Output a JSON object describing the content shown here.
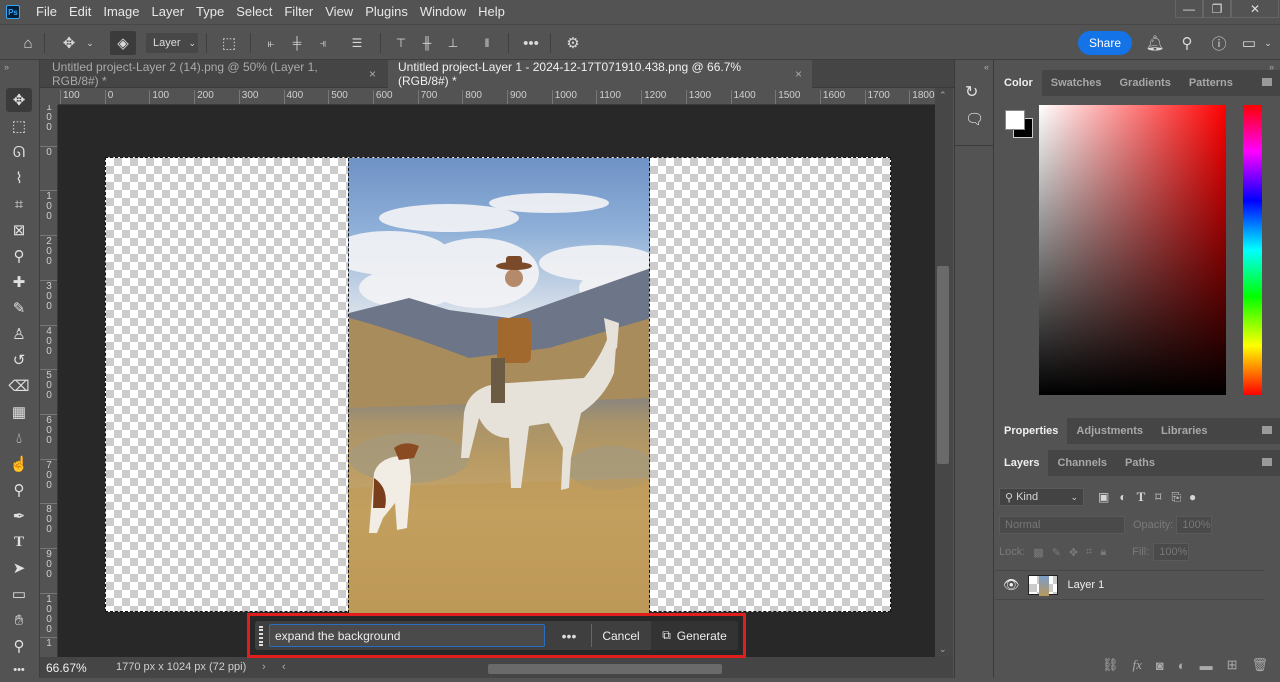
{
  "app": {
    "logo": "Ps",
    "name": "Photoshop"
  },
  "menu": [
    "File",
    "Edit",
    "Image",
    "Layer",
    "Type",
    "Select",
    "Filter",
    "View",
    "Plugins",
    "Window",
    "Help"
  ],
  "window_controls": {
    "minimize": "—",
    "restore": "❐",
    "close": "✕"
  },
  "options_bar": {
    "auto_select_target": "Layer",
    "share_label": "Share"
  },
  "tabs": [
    {
      "label": "Untitled project-Layer 2 (14).png @ 50% (Layer 1, RGB/8#) *",
      "active": false
    },
    {
      "label": "Untitled project-Layer 1 - 2024-12-17T071910.438.png @ 66.7% (RGB/8#) *",
      "active": true
    }
  ],
  "ruler": {
    "top": [
      "100",
      "0",
      "100",
      "200",
      "300",
      "400",
      "500",
      "600",
      "700",
      "800",
      "900",
      "1000",
      "1100",
      "1200",
      "1300",
      "1400",
      "1500",
      "1600",
      "1700",
      "1800"
    ],
    "left": [
      "100",
      "0",
      "100",
      "200",
      "300",
      "400",
      "500",
      "600",
      "700",
      "800",
      "900",
      "1000",
      "1"
    ]
  },
  "tools": [
    "move",
    "rectangular-marquee",
    "lasso",
    "object-selection",
    "crop",
    "frame",
    "eyedropper",
    "spot-healing",
    "brush",
    "clone-stamp",
    "history-brush",
    "eraser",
    "gradient",
    "blur",
    "smudge",
    "dodge",
    "pen",
    "type",
    "path-selection",
    "rectangle",
    "hand",
    "zoom",
    "more"
  ],
  "status": {
    "zoom": "66.67%",
    "doc_info": "1770 px x 1024 px (72 ppi)"
  },
  "contextual_task_bar": {
    "prompt_value": "expand the background",
    "more_label": "•••",
    "cancel_label": "Cancel",
    "generate_label": "Generate",
    "highlight_color": "#e01e1e"
  },
  "color_panel": {
    "tabs": [
      "Color",
      "Swatches",
      "Gradients",
      "Patterns"
    ],
    "active_tab": "Color",
    "foreground": "#ffffff",
    "background": "#000000",
    "hue": "#ff0000"
  },
  "properties_panel": {
    "tabs": [
      "Properties",
      "Adjustments",
      "Libraries"
    ],
    "active_tab": "Properties"
  },
  "layers_panel": {
    "tabs": [
      "Layers",
      "Channels",
      "Paths"
    ],
    "active_tab": "Layers",
    "filter_kind": "Kind",
    "blend_mode": "Normal",
    "opacity_label": "Opacity:",
    "opacity": "100%",
    "lock_label": "Lock:",
    "fill_label": "Fill:",
    "fill": "100%",
    "layers": [
      {
        "name": "Layer 1",
        "visible": true
      }
    ]
  }
}
